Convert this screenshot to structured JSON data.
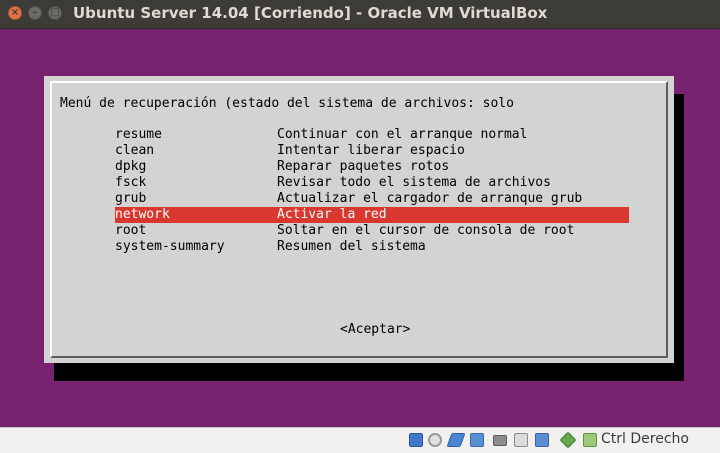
{
  "window": {
    "title": "Ubuntu Server 14.04 [Corriendo] - Oracle VM VirtualBox"
  },
  "dialog": {
    "header": "Menú de recuperación (estado del sistema de archivos: solo",
    "items": [
      {
        "command": "resume",
        "description": "Continuar con el arranque normal"
      },
      {
        "command": "clean",
        "description": "Intentar liberar espacio"
      },
      {
        "command": "dpkg",
        "description": "Reparar paquetes rotos"
      },
      {
        "command": "fsck",
        "description": "Revisar todo el sistema de archivos"
      },
      {
        "command": "grub",
        "description": "Actualizar el cargador de arranque grub"
      },
      {
        "command": "network",
        "description": "Activar la red"
      },
      {
        "command": "root",
        "description": "Soltar en el cursor de consola de root"
      },
      {
        "command": "system-summary",
        "description": "Resumen del sistema"
      }
    ],
    "selected_item": "network",
    "accept_button": "<Aceptar>"
  },
  "statusbar": {
    "icons": [
      "hard-disk-icon",
      "optical-drive-icon",
      "usb-icon",
      "shared-folders-icon",
      "display-icon",
      "video-capture-icon",
      "network-icon",
      "mouse-integration-icon",
      "keyboard-capture-icon"
    ],
    "host_key": "Ctrl Derecho"
  },
  "colors": {
    "vm_background": "#77216f",
    "dialog_bg": "#d3d3d3",
    "selection": "#d9382f",
    "titlebar": "#3c3b37"
  }
}
